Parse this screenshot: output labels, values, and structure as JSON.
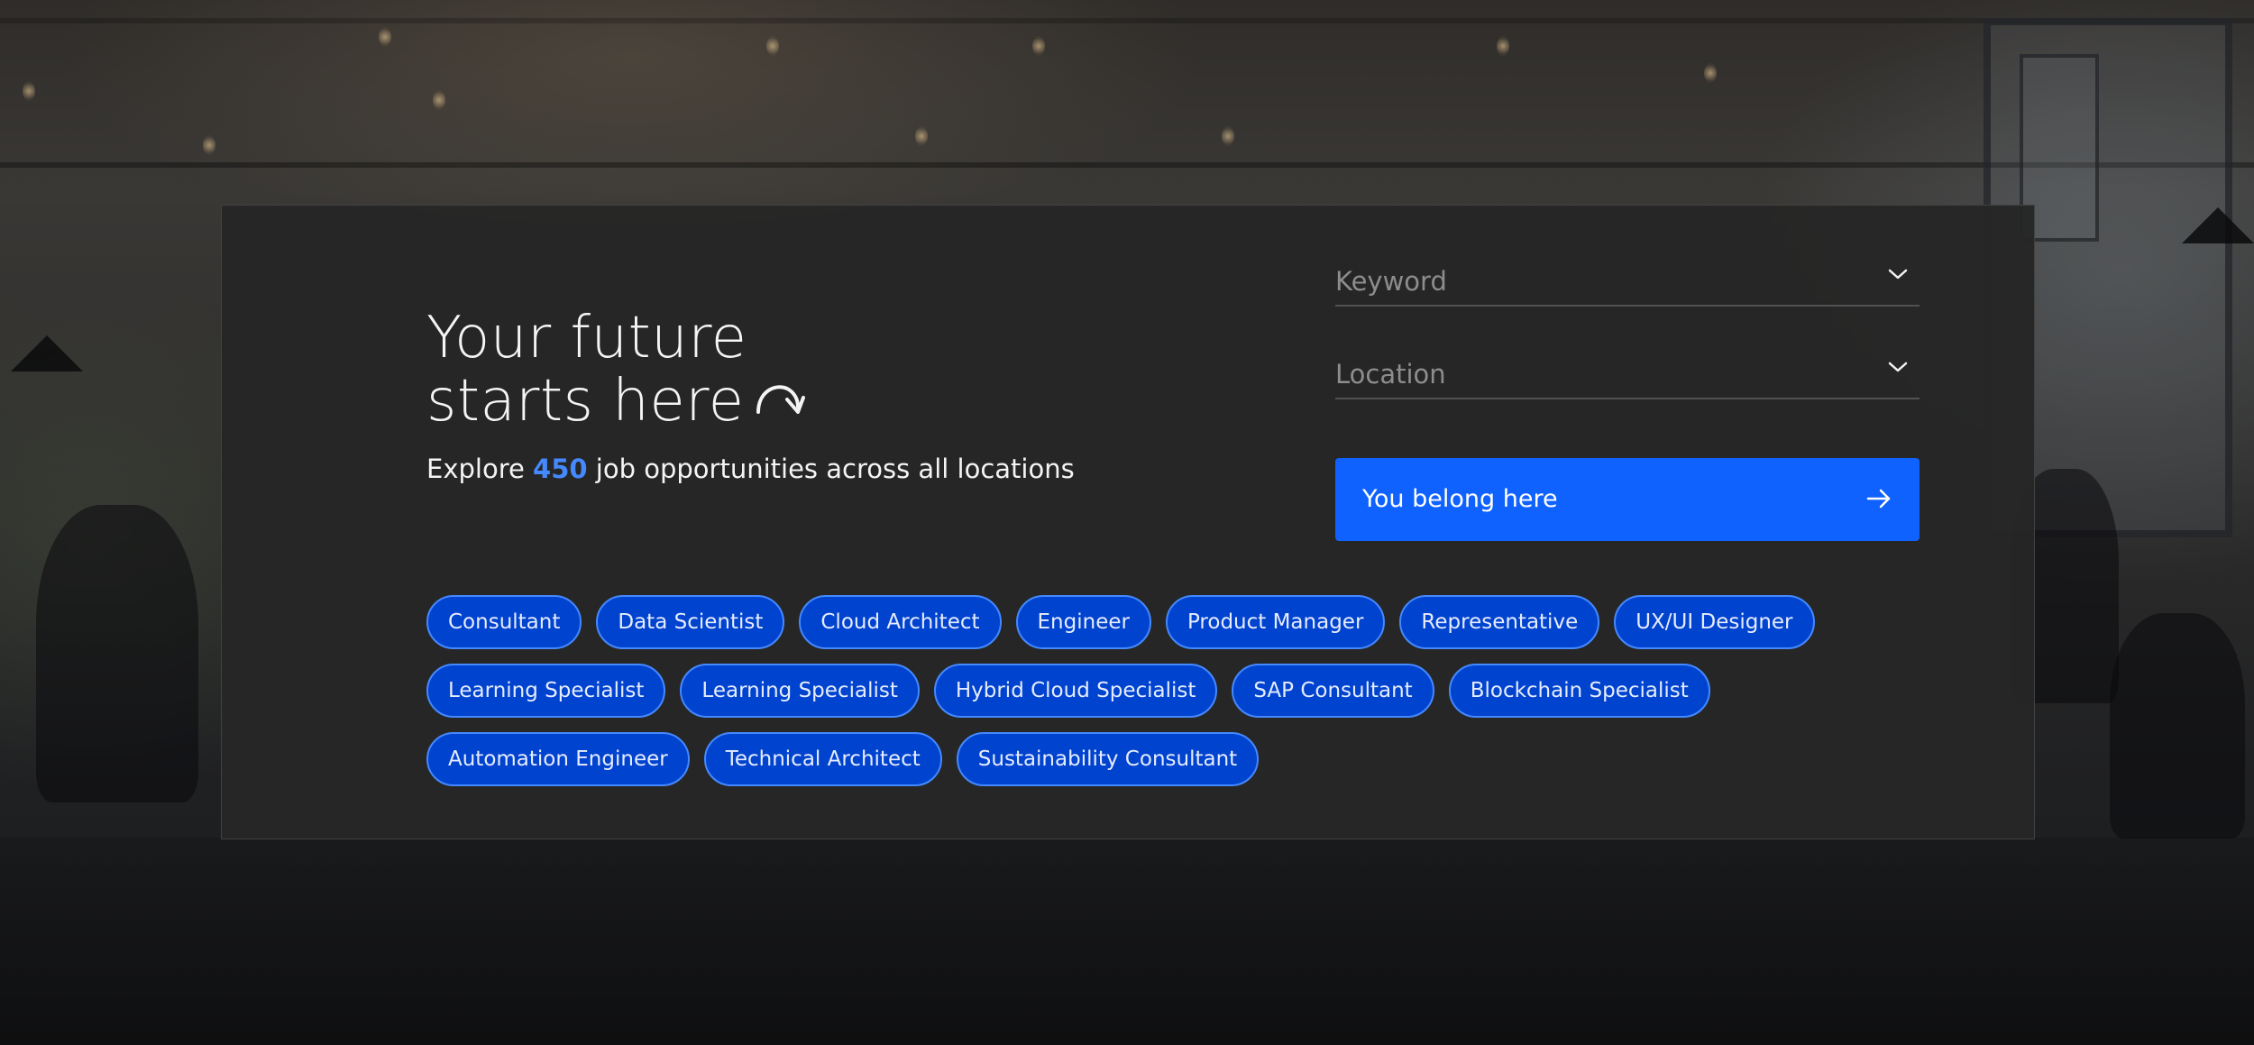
{
  "hero": {
    "headline_line1": "Your future",
    "headline_line2": "starts here",
    "subtitle_prefix": "Explore ",
    "job_count": "450",
    "subtitle_suffix": " job opportunities across all locations"
  },
  "search": {
    "keyword_placeholder": "Keyword",
    "location_placeholder": "Location",
    "submit_label": "You belong here"
  },
  "chips": [
    [
      "Consultant",
      "Data Scientist",
      "Cloud Architect",
      "Engineer",
      "Product Manager",
      "Representative",
      "UX/UI Designer"
    ],
    [
      "Learning Specialist",
      "Learning Specialist",
      "Hybrid Cloud Specialist",
      "SAP Consultant",
      "Blockchain Specialist"
    ],
    [
      "Automation Engineer",
      "Technical Architect",
      "Sustainability Consultant"
    ]
  ],
  "icons": {
    "headline_arrow": "curved-arrow-icon",
    "dropdown": "chevron-down-icon",
    "submit": "arrow-right-icon"
  },
  "colors": {
    "accent": "#0f62fe",
    "count_highlight": "#4589ff",
    "chip_fill": "#0043ce",
    "chip_border": "#4589ff",
    "card_background": "#262626"
  }
}
